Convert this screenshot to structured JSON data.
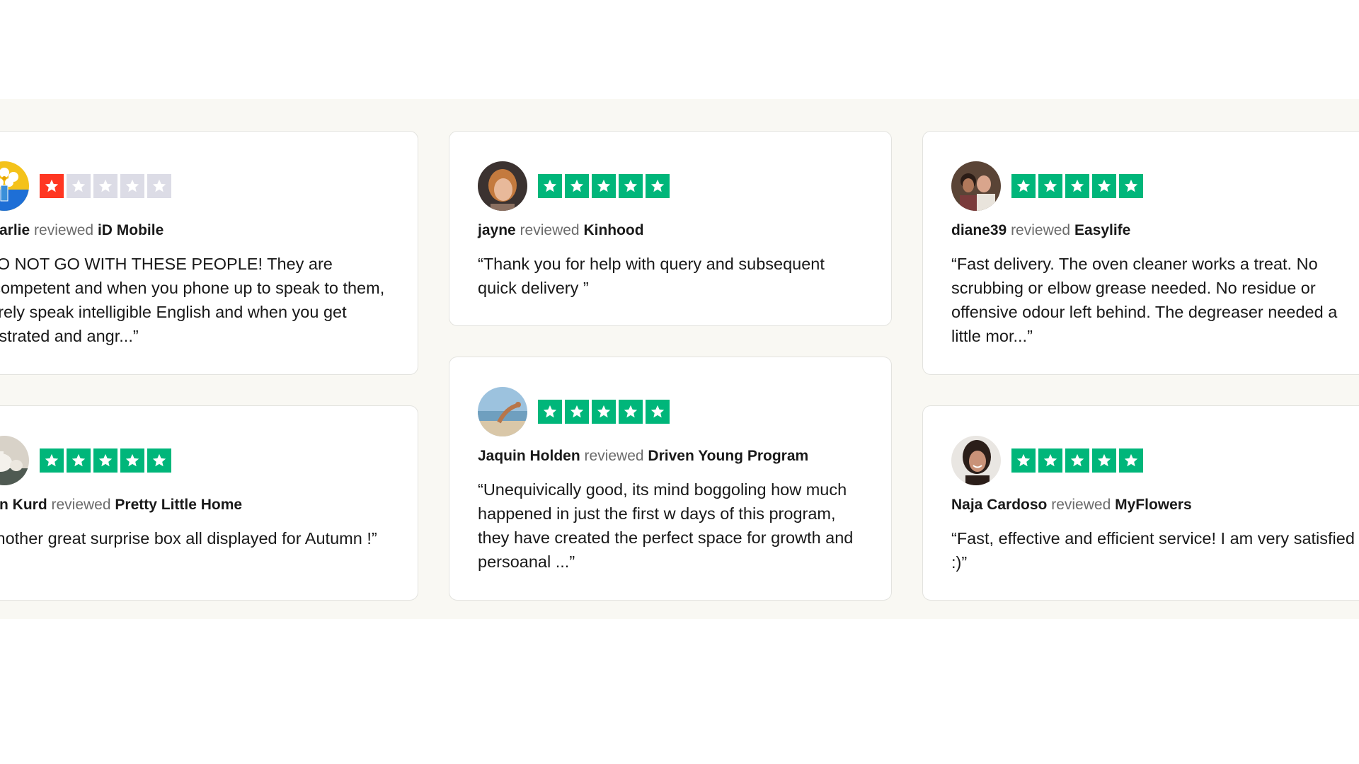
{
  "reviews": [
    {
      "reviewer": "Charlie",
      "connector": "reviewed",
      "company": "iD Mobile",
      "rating": 1,
      "avatar": "sunflower-vase-photo",
      "text": "“DO NOT GO WITH THESE PEOPLE! They are incompetent and when you phone up to speak to them, barely speak intelligible English and when you get frustrated and angr...”"
    },
    {
      "reviewer": "jayne",
      "connector": "reviewed",
      "company": "Kinhood",
      "rating": 5,
      "avatar": "woman-portrait-photo",
      "text": "“Thank you for help with query and subsequent quick delivery ”"
    },
    {
      "reviewer": "diane39",
      "connector": "reviewed",
      "company": "Easylife",
      "rating": 5,
      "avatar": "couple-photo",
      "text": "“Fast delivery. The oven cleaner works a treat. No scrubbing or elbow grease needed. No residue or offensive odour left behind. The degreaser needed a little mor...”"
    },
    {
      "reviewer": "Ann Kurd",
      "connector": "reviewed",
      "company": "Pretty Little Home",
      "rating": 5,
      "avatar": "teapot-photo",
      "text": "“Another great surprise box all displayed for Autumn !”"
    },
    {
      "reviewer": "Jaquin Holden",
      "connector": "reviewed",
      "company": "Driven Young Program",
      "rating": 5,
      "avatar": "beach-photo",
      "text": "“Unequivically good, its mind boggoling how much happened in just the first w days of this program, they have created the perfect space for growth and persoanal ...”"
    },
    {
      "reviewer": "Naja Cardoso",
      "connector": "reviewed",
      "company": "MyFlowers",
      "rating": 5,
      "avatar": "woman-smiling-photo",
      "text": "“Fast, effective and efficient service! I am very satisfied :)”"
    }
  ],
  "colors": {
    "star_5": "#00b67a",
    "star_1": "#ff3722",
    "star_empty": "#dcdce6",
    "section_bg": "#f9f8f3"
  }
}
